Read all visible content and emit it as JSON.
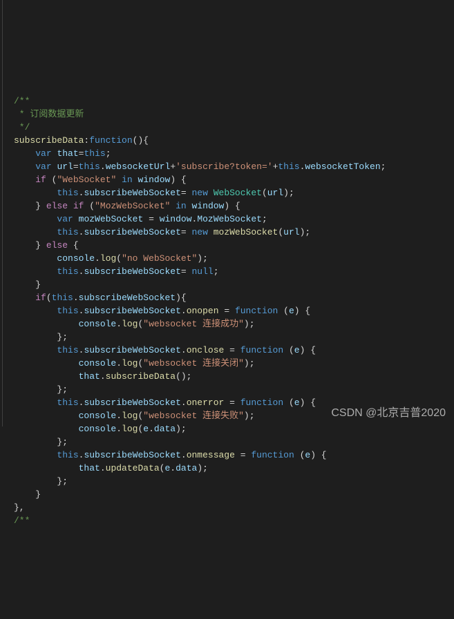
{
  "comment": {
    "open": "/**",
    "line": " * 订阅数据更新",
    "close": " */"
  },
  "fn": {
    "name": "subscribeData",
    "funcKw": "function"
  },
  "kw": {
    "var": "var",
    "if": "if",
    "else": "else",
    "in": "in",
    "new": "new",
    "this": "this",
    "null": "null",
    "function": "function"
  },
  "ids": {
    "that": "that",
    "url": "url",
    "websocketUrl": "websocketUrl",
    "websocketToken": "websocketToken",
    "subscribeWebSocket": "subscribeWebSocket",
    "WebSocket": "WebSocket",
    "MozWebSocket": "MozWebSocket",
    "mozWebSocket": "mozWebSocket",
    "window": "window",
    "console": "console",
    "log": "log",
    "onopen": "onopen",
    "onclose": "onclose",
    "onerror": "onerror",
    "onmessage": "onmessage",
    "e": "e",
    "data": "data",
    "subscribeData": "subscribeData",
    "updateData": "updateData"
  },
  "str": {
    "subscribe": "'subscribe?token='",
    "wsLit": "\"WebSocket\"",
    "mozLit": "\"MozWebSocket\"",
    "noWs": "\"no WebSocket\"",
    "connOk": "\"websocket 连接成功\"",
    "connClose": "\"websocket 连接关闭\"",
    "connErr": "\"websocket 连接失败\""
  },
  "watermark": "CSDN @北京吉普2020"
}
